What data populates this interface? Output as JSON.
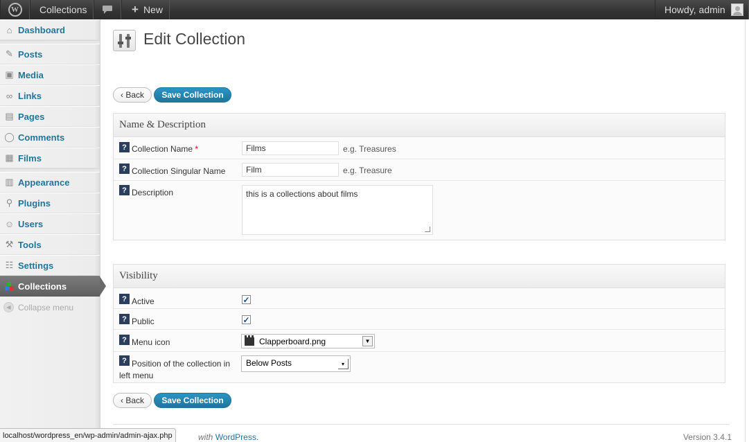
{
  "adminbar": {
    "site": "Collections",
    "new_label": "New",
    "howdy": "Howdy, admin"
  },
  "sidebar": {
    "items": [
      {
        "label": "Dashboard",
        "icon": "dashboard-icon"
      },
      {
        "label": "Posts",
        "icon": "pushpin-icon"
      },
      {
        "label": "Media",
        "icon": "media-icon"
      },
      {
        "label": "Links",
        "icon": "link-icon"
      },
      {
        "label": "Pages",
        "icon": "page-icon"
      },
      {
        "label": "Comments",
        "icon": "comment-icon"
      },
      {
        "label": "Films",
        "icon": "film-icon"
      },
      {
        "label": "Appearance",
        "icon": "appearance-icon"
      },
      {
        "label": "Plugins",
        "icon": "plugin-icon"
      },
      {
        "label": "Users",
        "icon": "users-icon"
      },
      {
        "label": "Tools",
        "icon": "tools-icon"
      },
      {
        "label": "Settings",
        "icon": "settings-icon"
      },
      {
        "label": "Collections",
        "icon": "collections-icon",
        "active": true
      }
    ],
    "collapse": "Collapse menu"
  },
  "page": {
    "title": "Edit Collection",
    "back_label": "‹ Back",
    "save_label": "Save Collection"
  },
  "name_section": {
    "title": "Name & Description",
    "name_label": "Collection Name",
    "name_required": "*",
    "name_value": "Films",
    "name_hint": "e.g. Treasures",
    "singular_label": "Collection Singular Name",
    "singular_value": "Film",
    "singular_hint": "e.g. Treasure",
    "description_label": "Description",
    "description_value": "this is a collections about films"
  },
  "visibility_section": {
    "title": "Visibility",
    "active_label": "Active",
    "active_checked": true,
    "public_label": "Public",
    "public_checked": true,
    "menu_icon_label": "Menu icon",
    "menu_icon_value": "Clapperboard.png",
    "position_label": "Position of the collection in left menu",
    "position_value": "Below Posts"
  },
  "footer": {
    "thanks_prefix": "with ",
    "thanks_link": "WordPress.",
    "version": "Version 3.4.1"
  },
  "status_bar": {
    "url": "localhost/wordpress_en/wp-admin/admin-ajax.php"
  },
  "colors": {
    "link": "#21759b",
    "adminbar": "#333333",
    "help_icon": "#2b3e5e",
    "required": "#dd0000"
  }
}
